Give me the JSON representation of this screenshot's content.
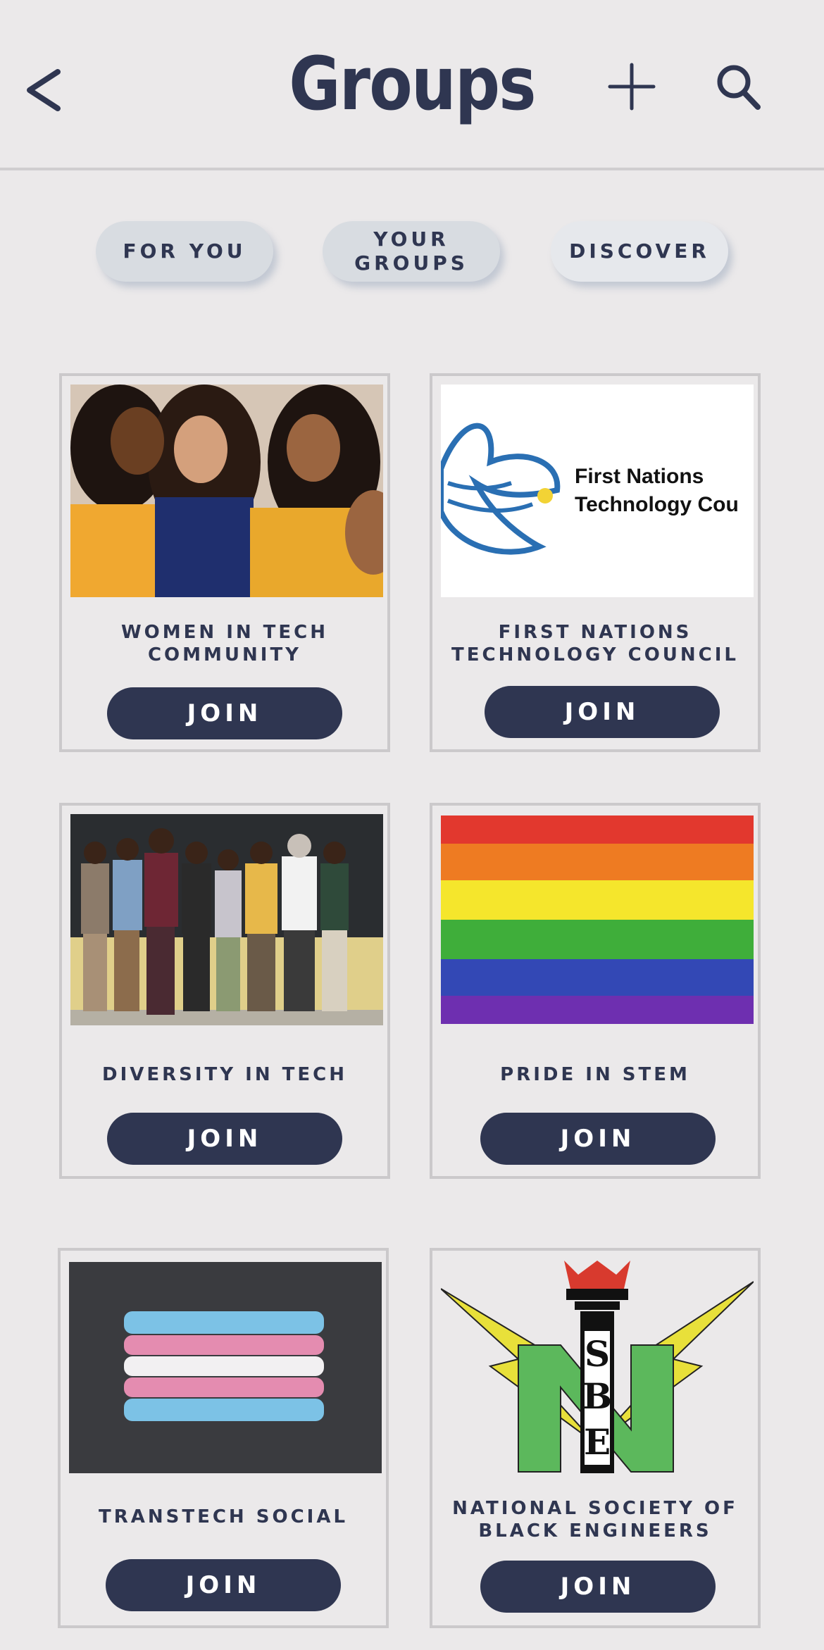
{
  "header": {
    "title": "Groups",
    "back_icon": "chevron-left-icon",
    "add_icon": "plus-icon",
    "search_icon": "search-icon"
  },
  "tabs": [
    {
      "label": "FOR YOU"
    },
    {
      "label": "YOUR GROUPS"
    },
    {
      "label": "DISCOVER",
      "active": true
    }
  ],
  "groups": [
    {
      "name": "WOMEN IN TECH COMMUNITY",
      "join_label": "JOIN",
      "image": "three smiling women photo"
    },
    {
      "name": "FIRST NATIONS TECHNOLOGY COUNCIL",
      "join_label": "JOIN",
      "image": "first nations logo",
      "logo_text": [
        "First Nations",
        "Technology Cou"
      ]
    },
    {
      "name": "DIVERSITY IN TECH",
      "join_label": "JOIN",
      "image": "group of people arms around each other"
    },
    {
      "name": "PRIDE IN STEM",
      "join_label": "JOIN",
      "image": "rainbow flag"
    },
    {
      "name": "TRANSTECH SOCIAL",
      "join_label": "JOIN",
      "image": "chalk trans flag on asphalt"
    },
    {
      "name": "NATIONAL SOCIETY OF BLACK ENGINEERS",
      "join_label": "JOIN",
      "image": "NSBE logo"
    }
  ],
  "colors": {
    "primary": "#2f3651",
    "background": "#ebe9ea",
    "tab": "#d8dce1"
  }
}
